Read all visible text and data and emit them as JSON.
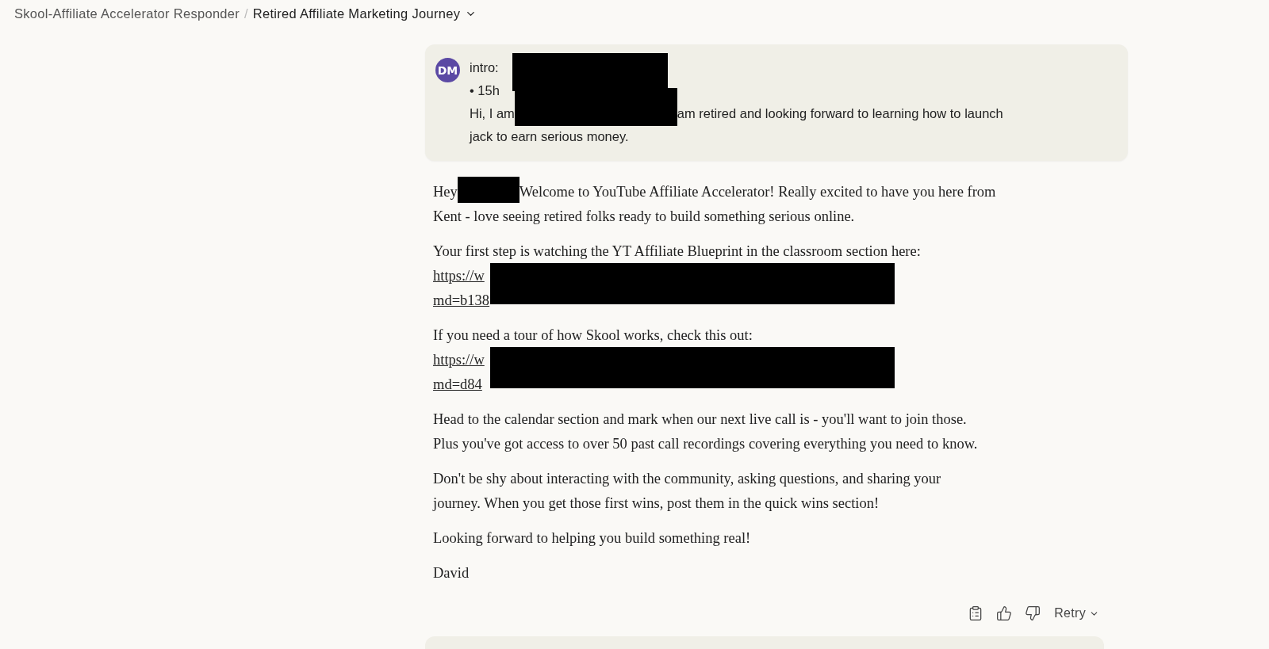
{
  "breadcrumb": {
    "project": "Skool-Affiliate Accelerator Responder",
    "separator": "/",
    "chat_title": "Retired Affiliate Marketing Journey"
  },
  "user_message": {
    "avatar": "DM",
    "header": "intro:",
    "time": "• 15h",
    "text_before": "Hi, I am",
    "text_after": [
      "am retired and looking forward to learning how to launch",
      "jack to earn serious money."
    ]
  },
  "reply": {
    "paragraphs": [
      {
        "kind": "greeting",
        "before": "Hey",
        "after": [
          "Welcome to YouTube Affiliate Accelerator! Really excited to have you here from",
          "Kent - love seeing retired folks ready to build something serious online."
        ]
      },
      {
        "kind": "link",
        "text": "Your first step is watching the YT Affiliate Blueprint in the classroom section here:",
        "link_lines": [
          "https://w",
          "md=b138"
        ]
      },
      {
        "kind": "link",
        "text": "If you need a tour of how Skool works, check this out:",
        "link_lines": [
          "https://w",
          "md=d84"
        ]
      },
      {
        "kind": "text",
        "text": "Head to the calendar section and mark when our next live call is - you'll want to join those. Plus you've got access to over 50 past call recordings covering everything you need to know."
      },
      {
        "kind": "text",
        "text": "Don't be shy about interacting with the community, asking questions, and sharing your journey. When you get those first wins, post them in the quick wins section!"
      },
      {
        "kind": "text",
        "text": "Looking forward to helping you build something real!"
      },
      {
        "kind": "text",
        "text": "David"
      }
    ]
  },
  "actions": {
    "retry": "Retry"
  }
}
